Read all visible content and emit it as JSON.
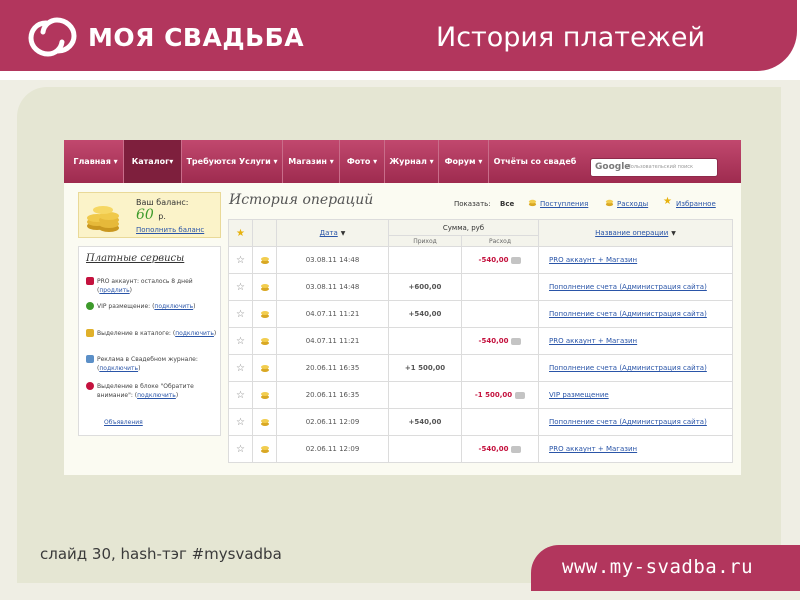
{
  "slide": {
    "brand": "МОЯ СВАДЬБА",
    "title": "История платежей",
    "caption": "слайд 30, hash-тэг #mysvadba",
    "url": "www.my-svadba.ru"
  },
  "nav": {
    "items": [
      "Главная",
      "Каталог",
      "Требуются Услуги",
      "Магазин",
      "Фото",
      "Журнал",
      "Форум",
      "Отчёты со свадеб"
    ],
    "active": "Каталог",
    "search_logo": "Google",
    "search_placeholder": "Пользовательский поиск"
  },
  "balance": {
    "label": "Ваш баланс:",
    "amount": "60",
    "unit": "р.",
    "topup_link": "Пополнить баланс"
  },
  "services": {
    "title": "Платные сервисы",
    "items": [
      {
        "text": "PRO аккаунт: осталось 8 дней",
        "link": "продлить",
        "color": "#c4123e"
      },
      {
        "text": "VIP размещение:",
        "link": "подключить",
        "color": "#3d9a2b"
      },
      {
        "text": "Выделение в каталоге:",
        "link": "подключить",
        "color": "#e0b02a"
      },
      {
        "text": "Реклама в Свадебном журнале:",
        "link": "подключить",
        "color": "#5b8fc7"
      },
      {
        "text": "Выделение в блоке \"Обратите внимание\":",
        "link": "подключить",
        "color": "#c4123e"
      }
    ],
    "ads_link": "Объявления"
  },
  "operations": {
    "title": "История операций",
    "filter_label": "Показать:",
    "filters": [
      "Все",
      "Поступления",
      "Расходы",
      "Избранное"
    ],
    "header": {
      "date": "Дата",
      "sum": "Сумма, руб",
      "income": "Приход",
      "expense": "Расход",
      "name": "Название операции"
    },
    "rows": [
      {
        "date": "03.08.11 14:48",
        "income": "",
        "expense": "-540,00",
        "name": "PRO аккаунт + Магазин"
      },
      {
        "date": "03.08.11 14:48",
        "income": "+600,00",
        "expense": "",
        "name": "Пополнение счета (Администрация сайта)"
      },
      {
        "date": "04.07.11 11:21",
        "income": "+540,00",
        "expense": "",
        "name": "Пополнение счета (Администрация сайта)"
      },
      {
        "date": "04.07.11 11:21",
        "income": "",
        "expense": "-540,00",
        "name": "PRO аккаунт + Магазин"
      },
      {
        "date": "20.06.11 16:35",
        "income": "+1 500,00",
        "expense": "",
        "name": "Пополнение счета (Администрация сайта)"
      },
      {
        "date": "20.06.11 16:35",
        "income": "",
        "expense": "-1 500,00",
        "name": "VIP размещение"
      },
      {
        "date": "02.06.11 12:09",
        "income": "+540,00",
        "expense": "",
        "name": "Пополнение счета (Администрация сайта)"
      },
      {
        "date": "02.06.11 12:09",
        "income": "",
        "expense": "-540,00",
        "name": "PRO аккаунт + Магазин"
      }
    ]
  },
  "colors": {
    "brand": "#b2365d",
    "income": "#2f9a2f",
    "expense": "#c4123e",
    "link": "#2a55a8"
  }
}
